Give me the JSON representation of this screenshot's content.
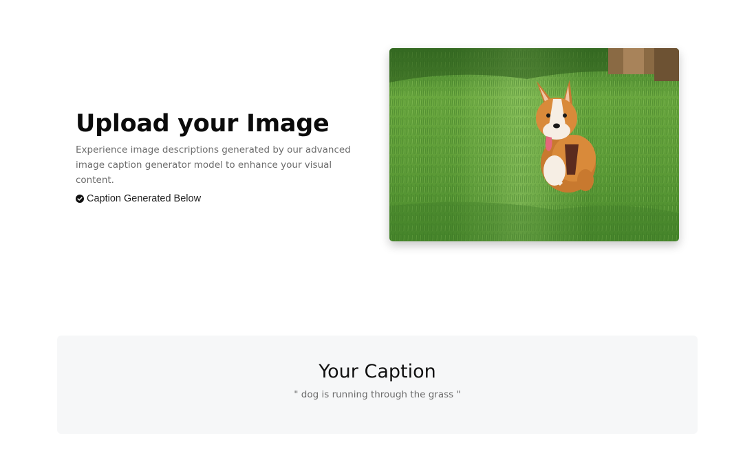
{
  "hero": {
    "title": "Upload your Image",
    "description": "Experience image descriptions generated by our advanced image caption generator model to enhance your visual content.",
    "status_text": "Caption Generated Below",
    "status_icon": "check-circle-icon"
  },
  "uploaded_image": {
    "subject": "corgi running on grass"
  },
  "caption_section": {
    "title": "Your Caption",
    "caption": "\" dog is running through the grass \""
  }
}
